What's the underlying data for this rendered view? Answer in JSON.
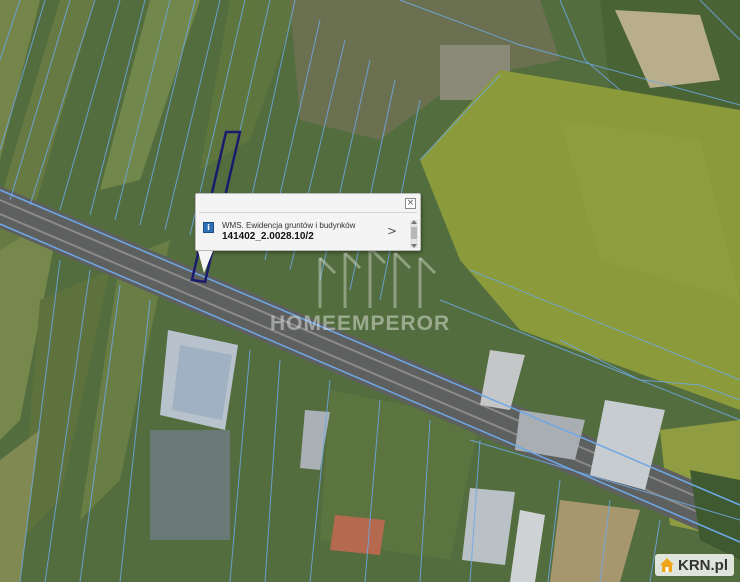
{
  "map": {
    "description_free": true
  },
  "popup": {
    "info_icon": "i",
    "layer_label": "WMS. Ewidencja gruntów i budynków",
    "parcel_id": "141402_2.0028.10/2",
    "close_symbol": "×",
    "next_symbol": ">"
  },
  "watermark": {
    "text": "HOMEEMPEROR"
  },
  "badge": {
    "text": "KRN.pl",
    "accent": "#f0a51c"
  },
  "colors": {
    "parcel_lines": "#6ea8e6",
    "selected_parcel": "#1b1b6e",
    "field_yellow": "#8c9a3a"
  }
}
